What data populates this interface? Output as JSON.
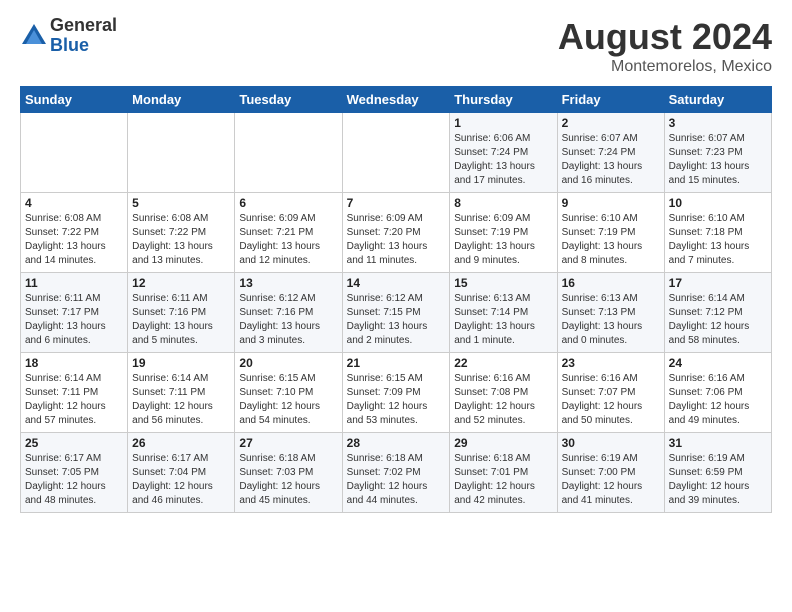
{
  "logo": {
    "general": "General",
    "blue": "Blue"
  },
  "header": {
    "title": "August 2024",
    "subtitle": "Montemorelos, Mexico"
  },
  "weekdays": [
    "Sunday",
    "Monday",
    "Tuesday",
    "Wednesday",
    "Thursday",
    "Friday",
    "Saturday"
  ],
  "weeks": [
    [
      {
        "day": "",
        "info": ""
      },
      {
        "day": "",
        "info": ""
      },
      {
        "day": "",
        "info": ""
      },
      {
        "day": "",
        "info": ""
      },
      {
        "day": "1",
        "info": "Sunrise: 6:06 AM\nSunset: 7:24 PM\nDaylight: 13 hours and 17 minutes."
      },
      {
        "day": "2",
        "info": "Sunrise: 6:07 AM\nSunset: 7:24 PM\nDaylight: 13 hours and 16 minutes."
      },
      {
        "day": "3",
        "info": "Sunrise: 6:07 AM\nSunset: 7:23 PM\nDaylight: 13 hours and 15 minutes."
      }
    ],
    [
      {
        "day": "4",
        "info": "Sunrise: 6:08 AM\nSunset: 7:22 PM\nDaylight: 13 hours and 14 minutes."
      },
      {
        "day": "5",
        "info": "Sunrise: 6:08 AM\nSunset: 7:22 PM\nDaylight: 13 hours and 13 minutes."
      },
      {
        "day": "6",
        "info": "Sunrise: 6:09 AM\nSunset: 7:21 PM\nDaylight: 13 hours and 12 minutes."
      },
      {
        "day": "7",
        "info": "Sunrise: 6:09 AM\nSunset: 7:20 PM\nDaylight: 13 hours and 11 minutes."
      },
      {
        "day": "8",
        "info": "Sunrise: 6:09 AM\nSunset: 7:19 PM\nDaylight: 13 hours and 9 minutes."
      },
      {
        "day": "9",
        "info": "Sunrise: 6:10 AM\nSunset: 7:19 PM\nDaylight: 13 hours and 8 minutes."
      },
      {
        "day": "10",
        "info": "Sunrise: 6:10 AM\nSunset: 7:18 PM\nDaylight: 13 hours and 7 minutes."
      }
    ],
    [
      {
        "day": "11",
        "info": "Sunrise: 6:11 AM\nSunset: 7:17 PM\nDaylight: 13 hours and 6 minutes."
      },
      {
        "day": "12",
        "info": "Sunrise: 6:11 AM\nSunset: 7:16 PM\nDaylight: 13 hours and 5 minutes."
      },
      {
        "day": "13",
        "info": "Sunrise: 6:12 AM\nSunset: 7:16 PM\nDaylight: 13 hours and 3 minutes."
      },
      {
        "day": "14",
        "info": "Sunrise: 6:12 AM\nSunset: 7:15 PM\nDaylight: 13 hours and 2 minutes."
      },
      {
        "day": "15",
        "info": "Sunrise: 6:13 AM\nSunset: 7:14 PM\nDaylight: 13 hours and 1 minute."
      },
      {
        "day": "16",
        "info": "Sunrise: 6:13 AM\nSunset: 7:13 PM\nDaylight: 13 hours and 0 minutes."
      },
      {
        "day": "17",
        "info": "Sunrise: 6:14 AM\nSunset: 7:12 PM\nDaylight: 12 hours and 58 minutes."
      }
    ],
    [
      {
        "day": "18",
        "info": "Sunrise: 6:14 AM\nSunset: 7:11 PM\nDaylight: 12 hours and 57 minutes."
      },
      {
        "day": "19",
        "info": "Sunrise: 6:14 AM\nSunset: 7:11 PM\nDaylight: 12 hours and 56 minutes."
      },
      {
        "day": "20",
        "info": "Sunrise: 6:15 AM\nSunset: 7:10 PM\nDaylight: 12 hours and 54 minutes."
      },
      {
        "day": "21",
        "info": "Sunrise: 6:15 AM\nSunset: 7:09 PM\nDaylight: 12 hours and 53 minutes."
      },
      {
        "day": "22",
        "info": "Sunrise: 6:16 AM\nSunset: 7:08 PM\nDaylight: 12 hours and 52 minutes."
      },
      {
        "day": "23",
        "info": "Sunrise: 6:16 AM\nSunset: 7:07 PM\nDaylight: 12 hours and 50 minutes."
      },
      {
        "day": "24",
        "info": "Sunrise: 6:16 AM\nSunset: 7:06 PM\nDaylight: 12 hours and 49 minutes."
      }
    ],
    [
      {
        "day": "25",
        "info": "Sunrise: 6:17 AM\nSunset: 7:05 PM\nDaylight: 12 hours and 48 minutes."
      },
      {
        "day": "26",
        "info": "Sunrise: 6:17 AM\nSunset: 7:04 PM\nDaylight: 12 hours and 46 minutes."
      },
      {
        "day": "27",
        "info": "Sunrise: 6:18 AM\nSunset: 7:03 PM\nDaylight: 12 hours and 45 minutes."
      },
      {
        "day": "28",
        "info": "Sunrise: 6:18 AM\nSunset: 7:02 PM\nDaylight: 12 hours and 44 minutes."
      },
      {
        "day": "29",
        "info": "Sunrise: 6:18 AM\nSunset: 7:01 PM\nDaylight: 12 hours and 42 minutes."
      },
      {
        "day": "30",
        "info": "Sunrise: 6:19 AM\nSunset: 7:00 PM\nDaylight: 12 hours and 41 minutes."
      },
      {
        "day": "31",
        "info": "Sunrise: 6:19 AM\nSunset: 6:59 PM\nDaylight: 12 hours and 39 minutes."
      }
    ]
  ]
}
